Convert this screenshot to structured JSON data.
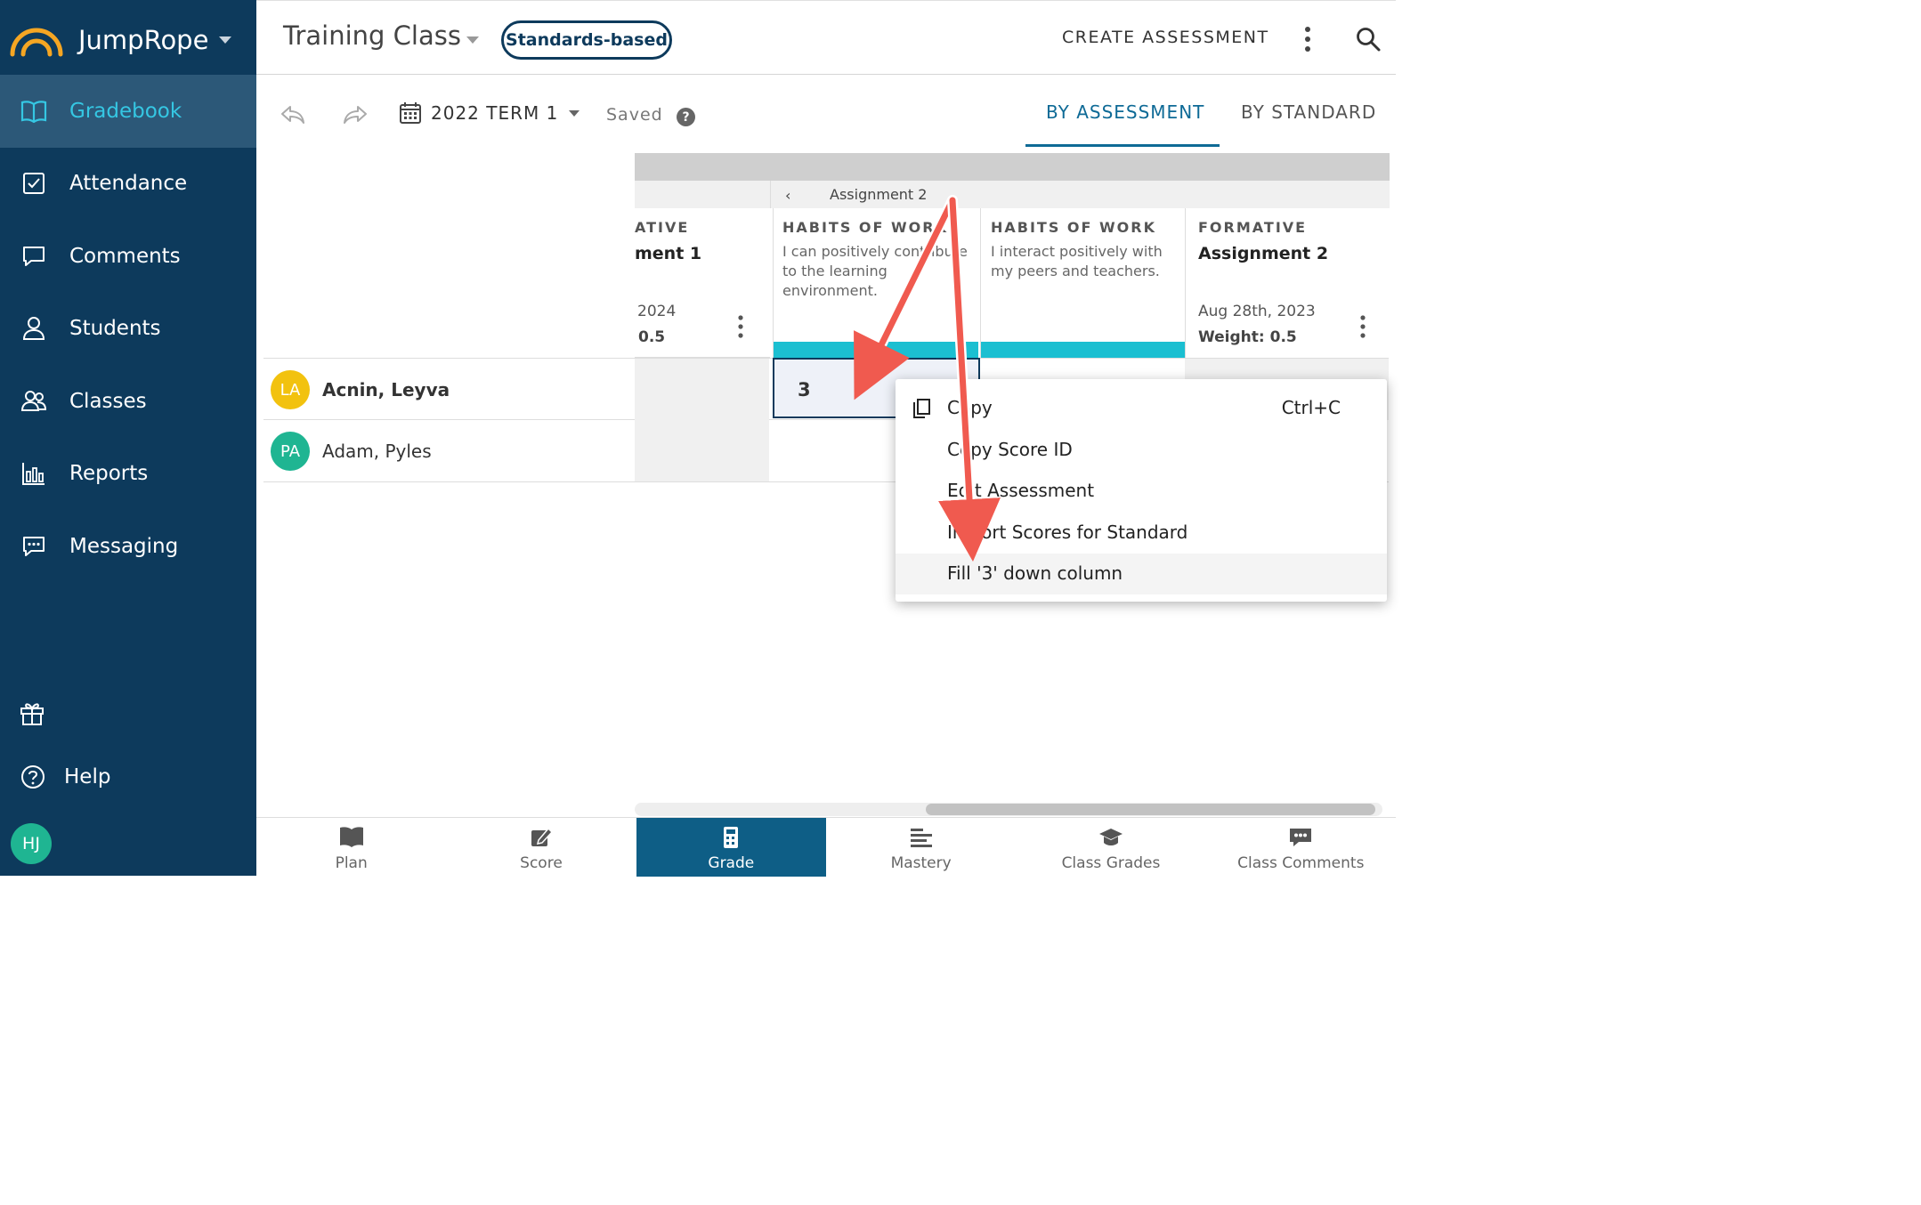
{
  "colors": {
    "sidebar_bg": "#0d3a5c",
    "sidebar_active": "#2c5878",
    "accent_teal": "#35c7e3",
    "tab_blue": "#0e6a96",
    "annotation_arrow": "#f05a4f"
  },
  "sidebar": {
    "brand": "JumpRope",
    "items": [
      {
        "label": "Gradebook",
        "icon": "book-open-icon",
        "active": true
      },
      {
        "label": "Attendance",
        "icon": "checkbox-icon"
      },
      {
        "label": "Comments",
        "icon": "speech-bubble-icon"
      },
      {
        "label": "Students",
        "icon": "person-icon"
      },
      {
        "label": "Classes",
        "icon": "people-icon"
      },
      {
        "label": "Reports",
        "icon": "bar-chart-icon"
      },
      {
        "label": "Messaging",
        "icon": "chat-dots-icon"
      }
    ],
    "gift_icon": "gift-icon",
    "help": "Help",
    "user_initials": "HJ"
  },
  "header": {
    "class_title": "Training Class",
    "grading_mode": "Standards-based",
    "create_label": "CREATE ASSESSMENT"
  },
  "toolbar": {
    "term": "2022 TERM 1",
    "status": "Saved",
    "help_glyph": "?",
    "tab_assessment": "BY ASSESSMENT",
    "tab_standard": "BY STANDARD"
  },
  "grid": {
    "assignment_group": "Assignment 2",
    "group_chevron": "‹",
    "columns": [
      {
        "type": "ATIVE",
        "name": "ment 1",
        "date": "2024",
        "weight": "0.5"
      },
      {
        "type": "HABITS OF WORK",
        "description": "I can positively contribute to the learning environment."
      },
      {
        "type": "HABITS OF WORK",
        "description": "I interact positively with my peers and teachers."
      },
      {
        "type": "FORMATIVE",
        "name": "Assignment 2",
        "date": "Aug 28th, 2023",
        "weight": "Weight: 0.5"
      }
    ],
    "students": [
      {
        "initials": "LA",
        "name": "Acnin, Leyva",
        "color": "#f2c20f"
      },
      {
        "initials": "PA",
        "name": "Adam, Pyles",
        "color": "#1fb592"
      }
    ],
    "selected_score": "3"
  },
  "context_menu": {
    "items": [
      {
        "label": "Copy",
        "shortcut": "Ctrl+C",
        "icon": "copy-icon"
      },
      {
        "label": "Copy Score ID"
      },
      {
        "label": "Edit Assessment"
      },
      {
        "label": "Import Scores for Standard"
      },
      {
        "label": "Fill '3' down column"
      }
    ]
  },
  "bottom_nav": [
    {
      "label": "Plan",
      "icon": "book-icon"
    },
    {
      "label": "Score",
      "icon": "pencil-square-icon"
    },
    {
      "label": "Grade",
      "icon": "calculator-icon",
      "active": true
    },
    {
      "label": "Mastery",
      "icon": "bars-icon"
    },
    {
      "label": "Class Grades",
      "icon": "graduation-cap-icon"
    },
    {
      "label": "Class Comments",
      "icon": "comment-dots-icon"
    }
  ]
}
